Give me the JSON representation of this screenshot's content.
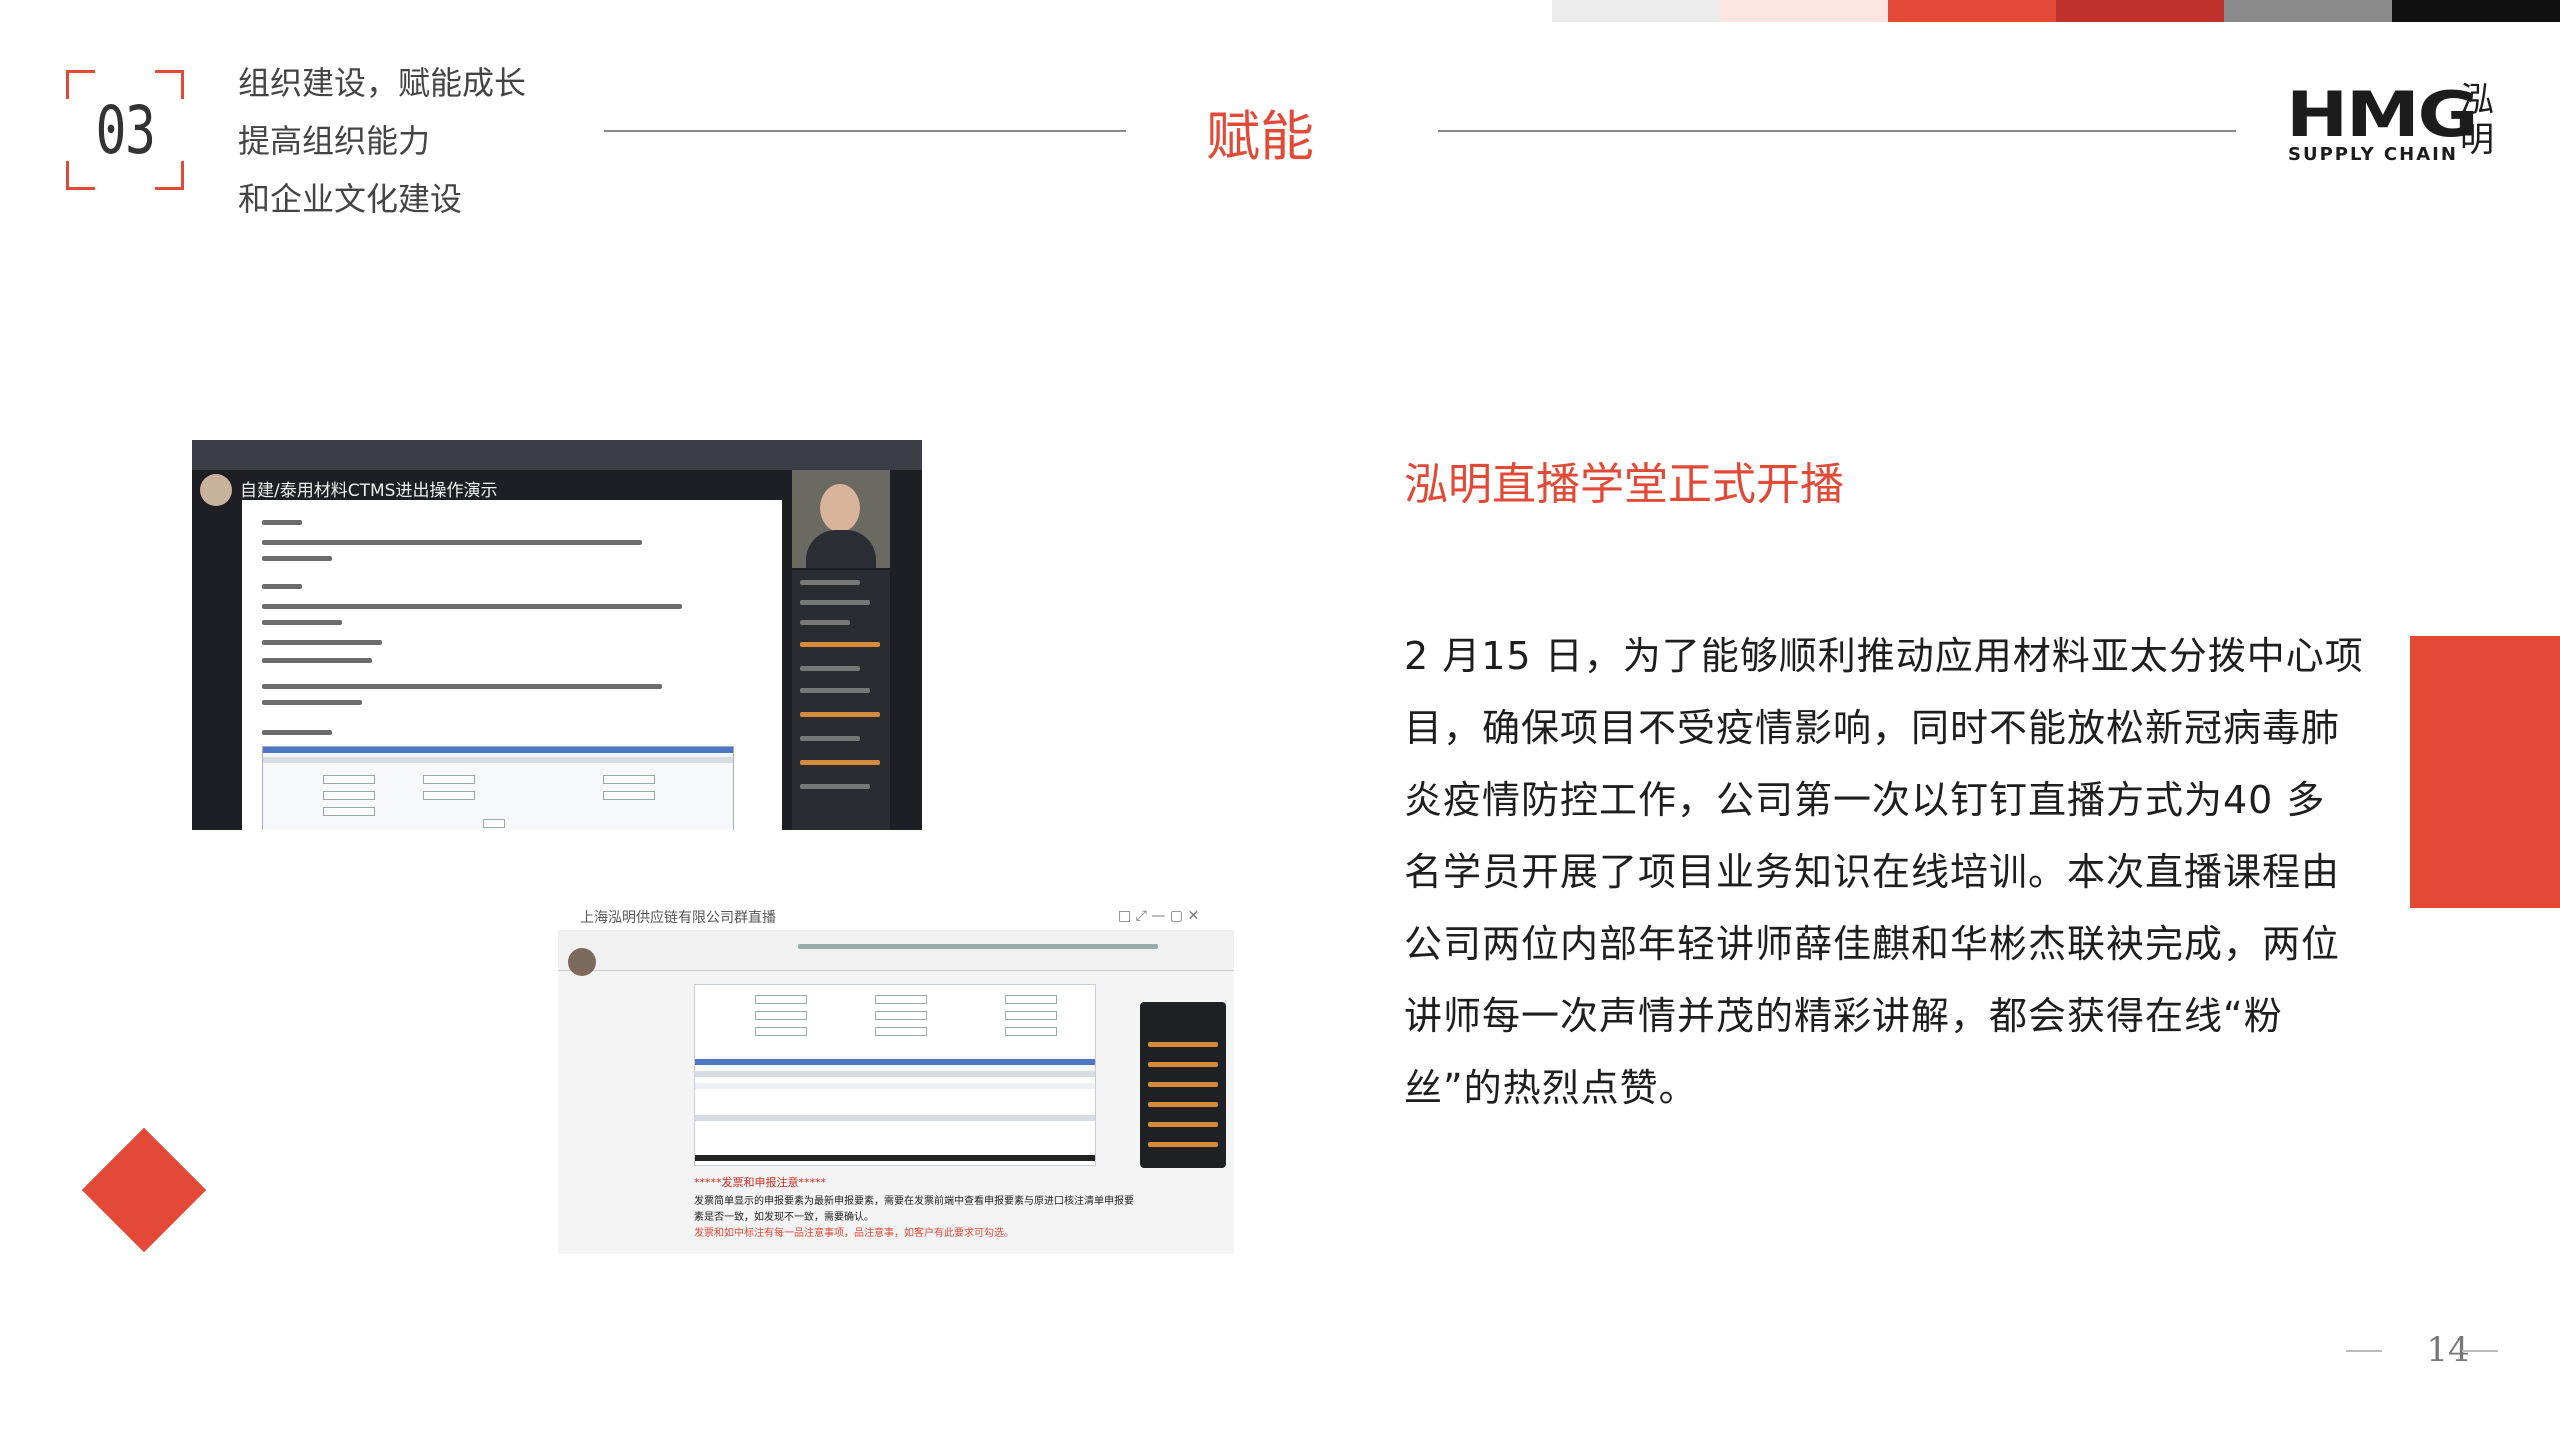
{
  "header": {
    "section_number": "03",
    "lines": [
      "组织建设，赋能成长",
      "提高组织能力",
      "和企业文化建设"
    ],
    "title": "赋能"
  },
  "logo": {
    "brand": "HMG",
    "tagline": "SUPPLY CHAIN",
    "cn": "泓明"
  },
  "strip_colors": [
    "#ececec",
    "#fbe4e2",
    "#e24a37",
    "#c0332c",
    "#8a8a8a",
    "#111111"
  ],
  "screenshot1": {
    "banner": "自建/泰用材料CTMS进出操作演示"
  },
  "screenshot2": {
    "window_title": "上海泓明供应链有限公司群直播",
    "note_title": "*****发票和申报注意*****",
    "note_lines": [
      "发票简单显示的申报要素为最新申报要素，需要在发票前端中查看申报要素与原进口核注清单申报要",
      "素是否一致，如发现不一致，需要确认。"
    ],
    "note_red": "发票和如中标注有每一品注意事项，品注意事，如客户有此要求可勾选。"
  },
  "content": {
    "subtitle": "泓明直播学堂正式开播",
    "paragraph": "2 月15 日，为了能够顺利推动应用材料亚太分拨中心项目，确保项目不受疫情影响，同时不能放松新冠病毒肺炎疫情防控工作，公司第一次以钉钉直播方式为40 多名学员开展了项目业务知识在线培训。本次直播课程由公司两位内部年轻讲师薛佳麒和华彬杰联袂完成，两位讲师每一次声情并茂的精彩讲解，都会获得在线“粉丝”的热烈点赞。"
  },
  "page_number": "14"
}
